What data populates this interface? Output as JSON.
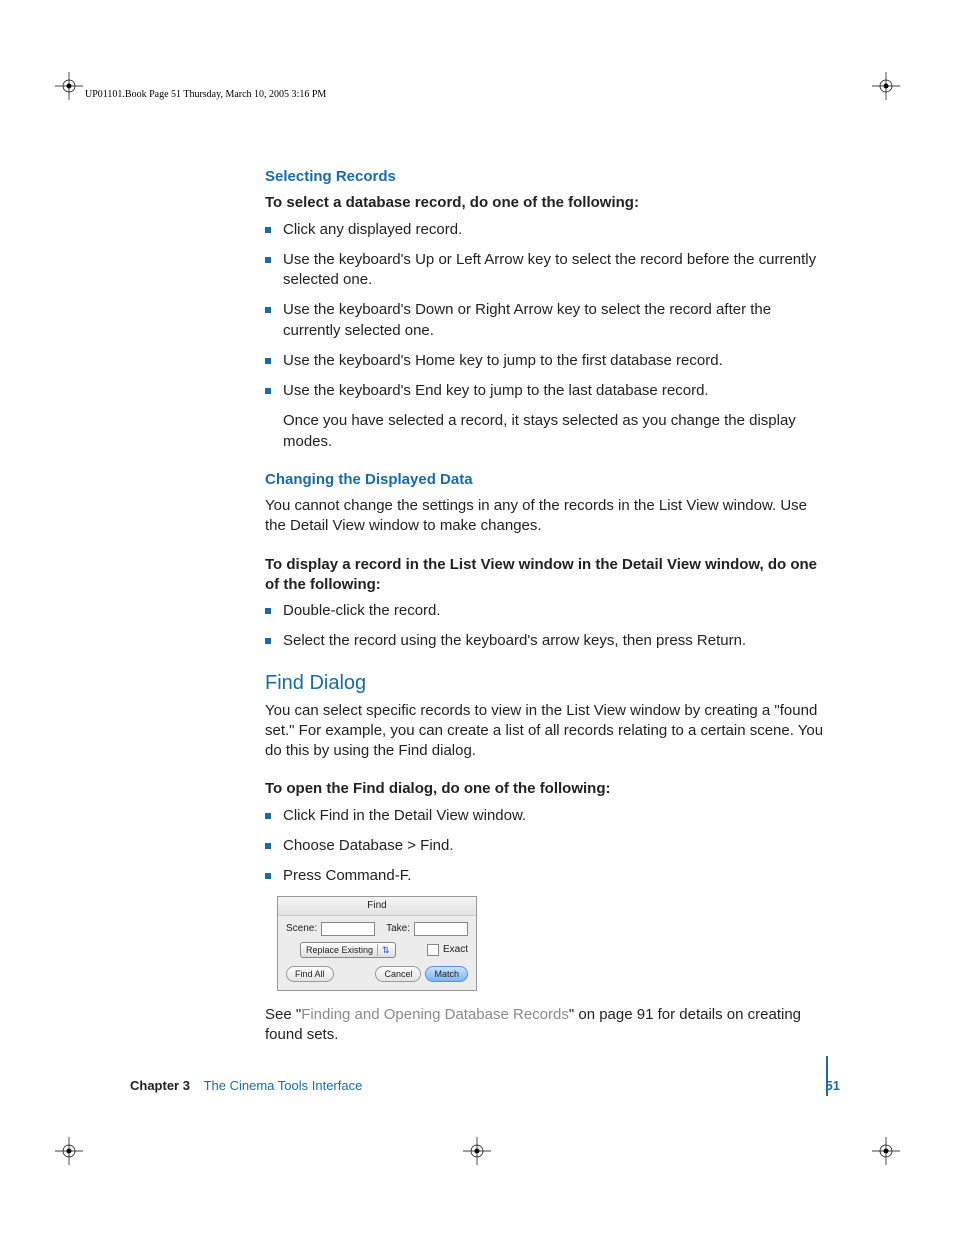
{
  "header_line": "UP01101.Book  Page 51  Thursday, March 10, 2005  3:16 PM",
  "section1": {
    "title": "Selecting Records",
    "lead": "To select a database record, do one of the following:",
    "bullets": [
      "Click any displayed record.",
      "Use the keyboard's Up or Left Arrow key to select the record before the currently selected one.",
      "Use the keyboard's Down or Right Arrow key to select the record after the currently selected one.",
      "Use the keyboard's Home key to jump to the first database record.",
      "Use the keyboard's End key to jump to the last database record."
    ],
    "after": "Once you have selected a record, it stays selected as you change the display modes."
  },
  "section2": {
    "title": "Changing the Displayed Data",
    "p1": "You cannot change the settings in any of the records in the List View window. Use the Detail View window to make changes.",
    "lead": "To display a record in the List View window in the Detail View window, do one of the following:",
    "bullets": [
      "Double-click the record.",
      "Select the record using the keyboard's arrow keys, then press Return."
    ]
  },
  "section3": {
    "title": "Find Dialog",
    "p1": "You can select specific records to view in the List View window by creating a \"found set.\" For example, you can create a list of all records relating to a certain scene. You do this by using the Find dialog.",
    "lead": "To open the Find dialog, do one of the following:",
    "bullets": [
      "Click Find in the Detail View window.",
      "Choose Database > Find.",
      "Press Command-F."
    ],
    "see_prefix": "See \"",
    "see_link": "Finding and Opening Database Records",
    "see_suffix": "\" on page 91 for details on creating found sets."
  },
  "find_dialog": {
    "title": "Find",
    "scene_label": "Scene:",
    "take_label": "Take:",
    "select_label": "Replace Existing",
    "exact_label": "Exact",
    "find_all": "Find All",
    "cancel": "Cancel",
    "match": "Match"
  },
  "footer": {
    "chapter_label": "Chapter 3",
    "chapter_title": "The Cinema Tools Interface",
    "page_number": "51"
  }
}
